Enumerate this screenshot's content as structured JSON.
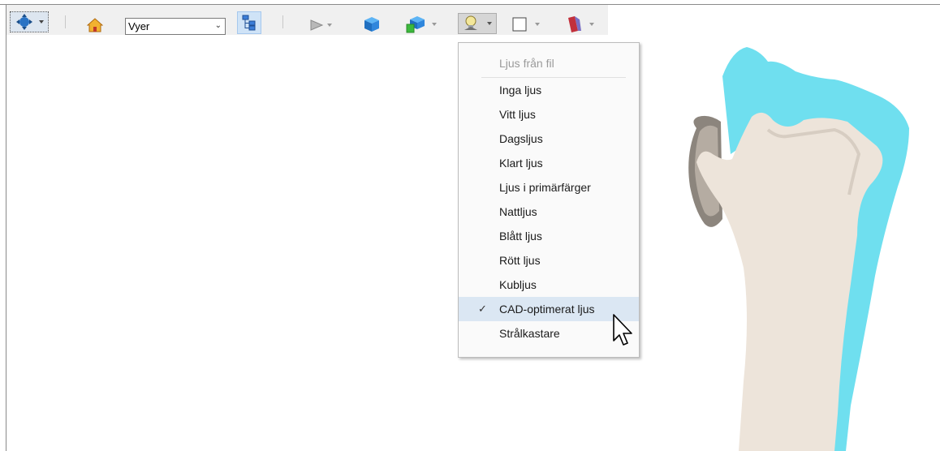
{
  "toolbar": {
    "views_select": {
      "value": "Vyer"
    },
    "icons": [
      "navigate-icon",
      "home-icon",
      "tree-icon",
      "play-icon",
      "cube-icon",
      "cubes-color-icon",
      "light-bulb-icon",
      "background-color-icon",
      "section-icon"
    ]
  },
  "light_menu": {
    "items": [
      {
        "label": "Ljus från fil",
        "enabled": false
      },
      {
        "label": "Inga ljus"
      },
      {
        "label": "Vitt ljus"
      },
      {
        "label": "Dagsljus"
      },
      {
        "label": "Klart ljus"
      },
      {
        "label": "Ljus i primärfärger"
      },
      {
        "label": "Nattljus"
      },
      {
        "label": "Blått ljus"
      },
      {
        "label": "Rött ljus"
      },
      {
        "label": "Kubljus"
      },
      {
        "label": "CAD-optimerat ljus",
        "checked": true
      },
      {
        "label": "Strålkastare"
      }
    ],
    "check_mark": "✓"
  },
  "colors": {
    "bone": "#ede4da",
    "cartilage": "#6fdfef",
    "selection": "#dbe7f3"
  }
}
